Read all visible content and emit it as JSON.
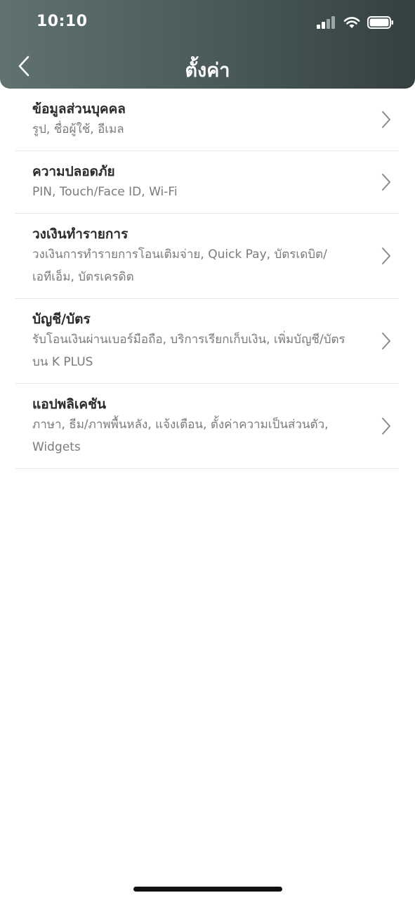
{
  "status_bar": {
    "time": "10:10"
  },
  "header": {
    "title": "ตั้งค่า"
  },
  "settings_items": [
    {
      "title": "ข้อมูลส่วนบุคคล",
      "subtitle": "รูป, ชื่อผู้ใช้, อีเมล"
    },
    {
      "title": "ความปลอดภัย",
      "subtitle": "PIN, Touch/Face ID, Wi-Fi"
    },
    {
      "title": "วงเงินทำรายการ",
      "subtitle": "วงเงินการทำรายการโอนเติมจ่าย, Quick Pay, บัตรเดบิต/เอทีเอ็ม, บัตรเครดิต"
    },
    {
      "title": "บัญชี/บัตร",
      "subtitle": "รับโอนเงินผ่านเบอร์มือถือ, บริการเรียกเก็บเงิน, เพิ่มบัญชี/บัตรบน K PLUS"
    },
    {
      "title": "แอปพลิเคชัน",
      "subtitle": "ภาษา, ธีม/ภาพพื้นหลัง, แจ้งเตือน, ตั้งค่าความเป็นส่วนตัว, Widgets"
    }
  ],
  "icons": {
    "back": "chevron-left-icon",
    "row_arrow": "chevron-right-icon",
    "signal": "cellular-signal-icon",
    "wifi": "wifi-icon",
    "battery": "battery-icon"
  },
  "colors": {
    "header_start": "#5f7270",
    "header_end": "#34403f",
    "title_text": "#2b2b2b",
    "subtitle_text": "#7b7b7b"
  }
}
